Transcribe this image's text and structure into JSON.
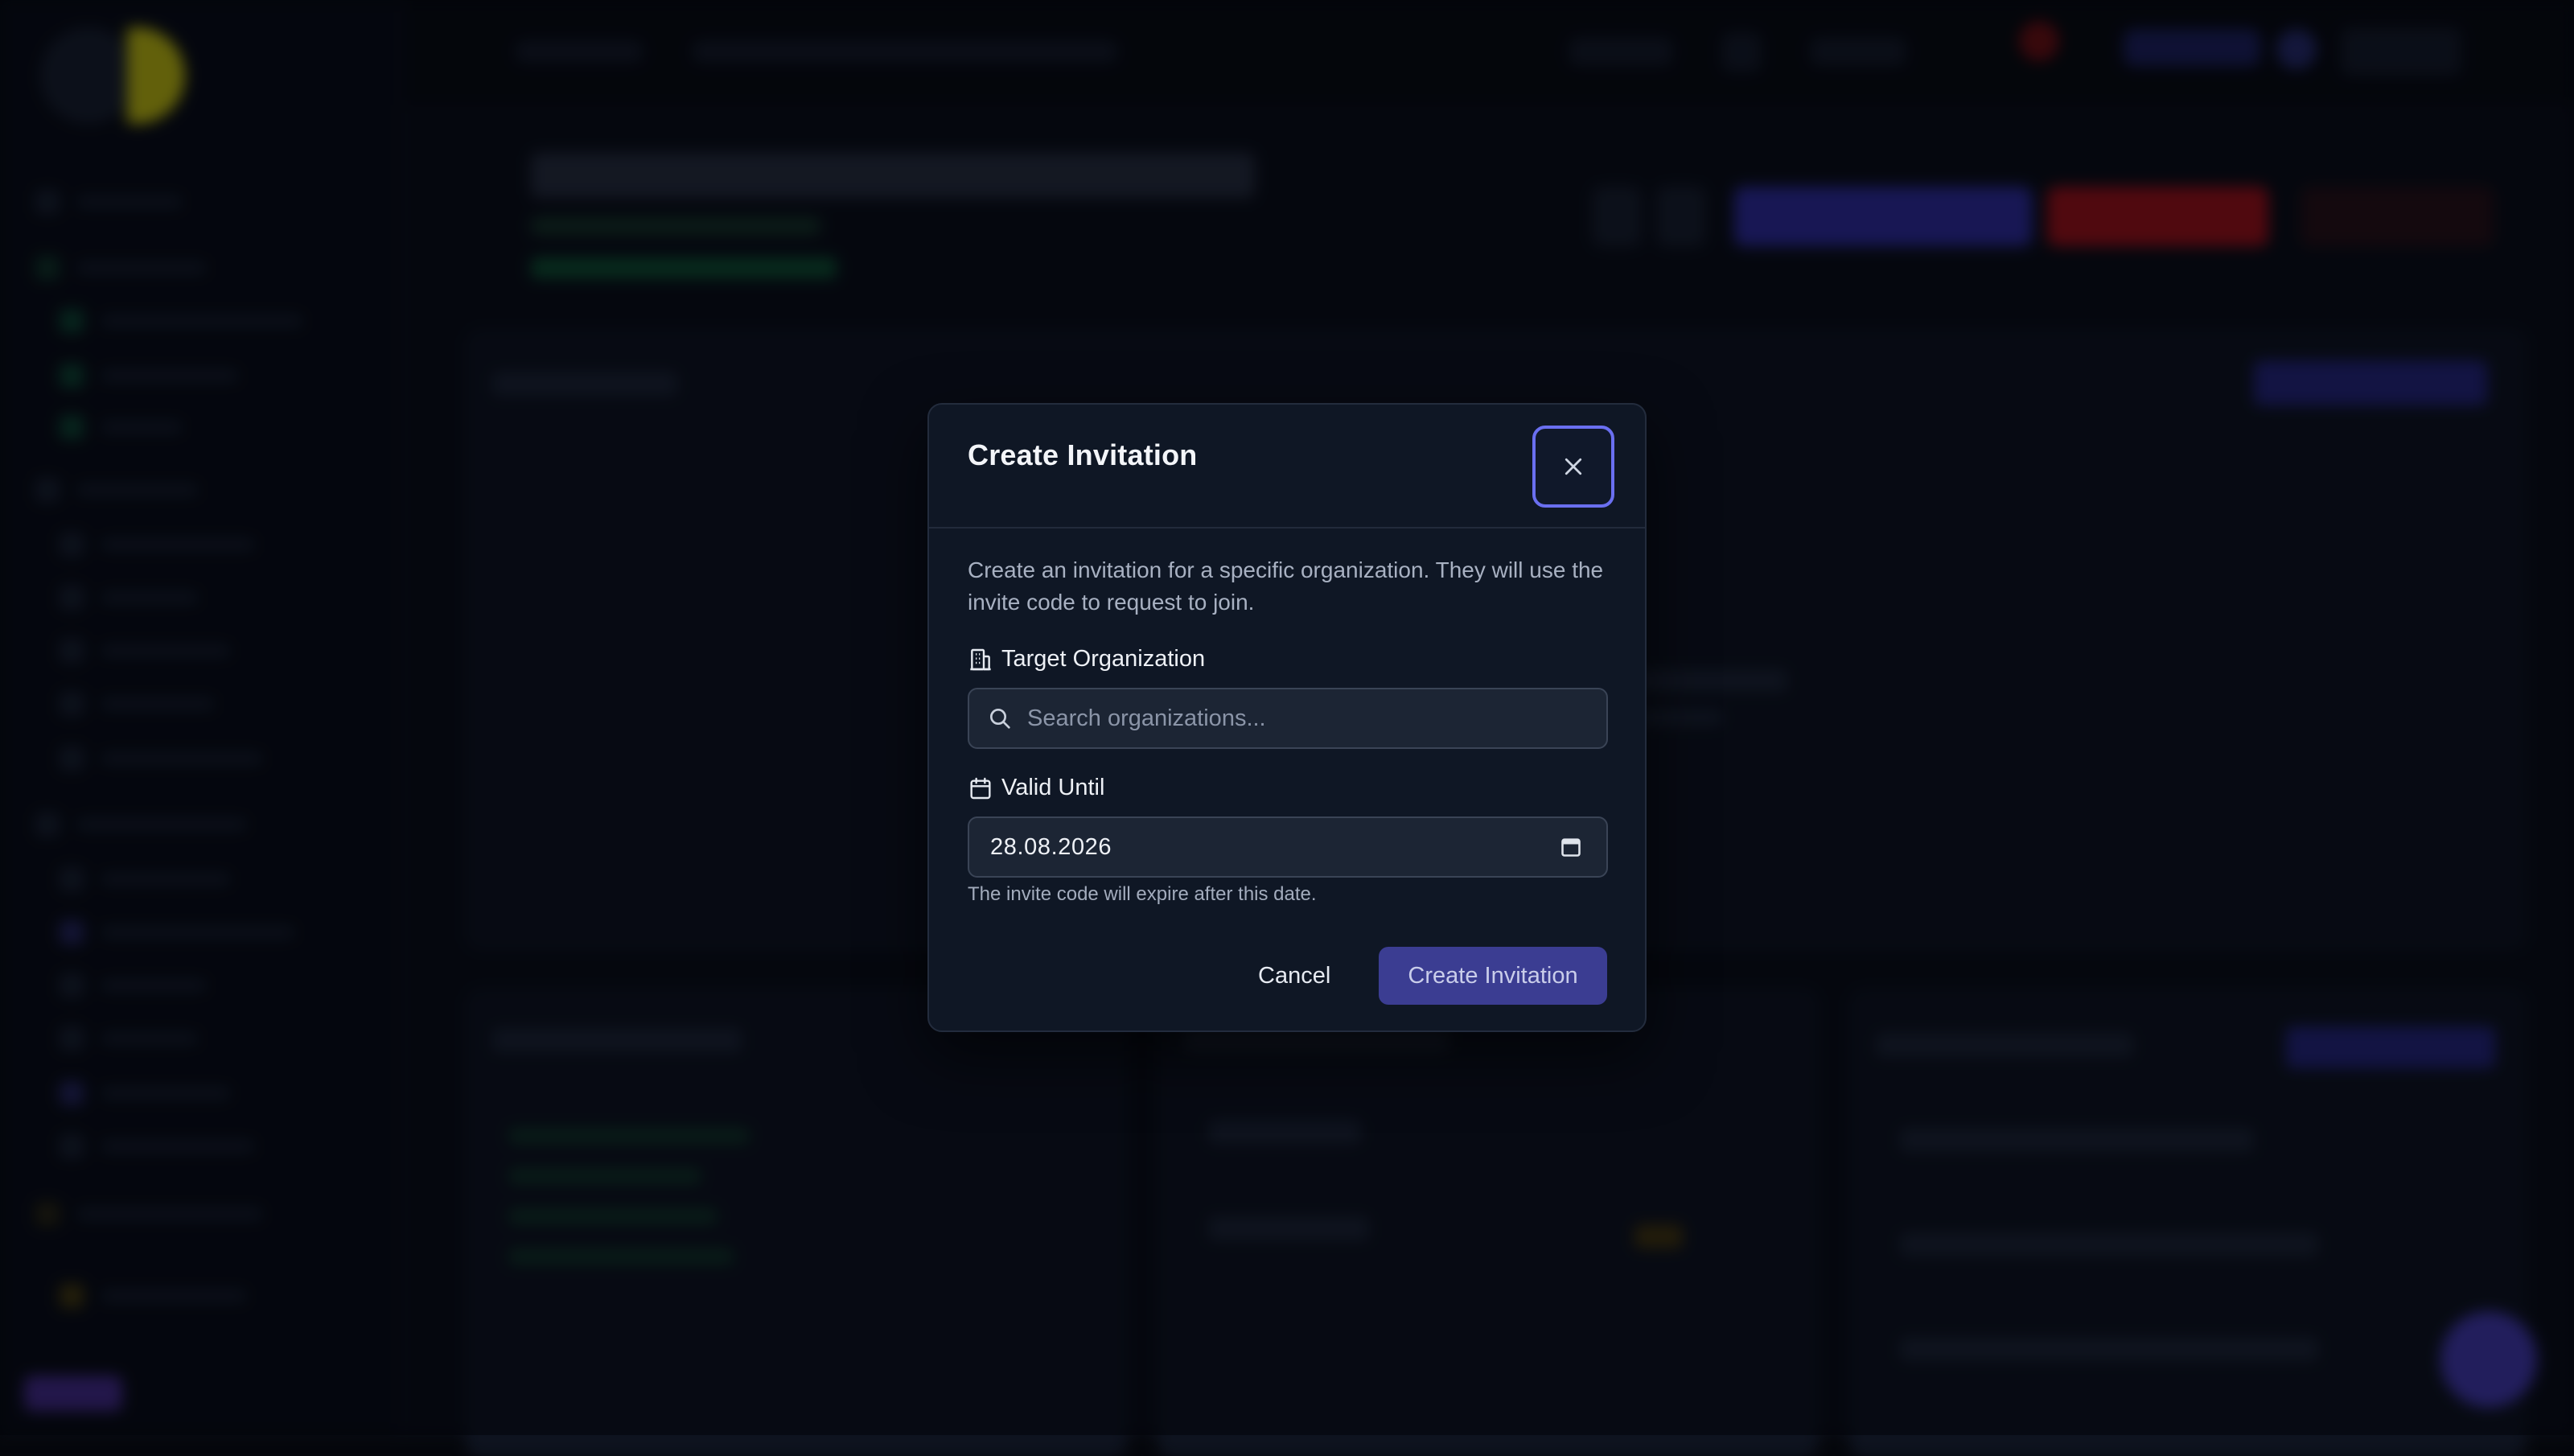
{
  "modal": {
    "title": "Create Invitation",
    "description": "Create an invitation for a specific organization. They will use the invite code to request to join.",
    "target_org": {
      "label": "Target Organization",
      "placeholder": "Search organizations...",
      "value": ""
    },
    "valid_until": {
      "label": "Valid Until",
      "value": "28.08.2026",
      "hint": "The invite code will expire after this date."
    },
    "buttons": {
      "cancel": "Cancel",
      "create": "Create Invitation"
    }
  },
  "colors": {
    "accent": "#6a6ff0",
    "primary_button": "#3b3d92",
    "modal_bg": "#0f1725",
    "input_bg": "#1c2534"
  },
  "icons": {
    "close": "close-icon",
    "building": "building-icon",
    "search": "search-icon",
    "calendar": "calendar-icon"
  }
}
